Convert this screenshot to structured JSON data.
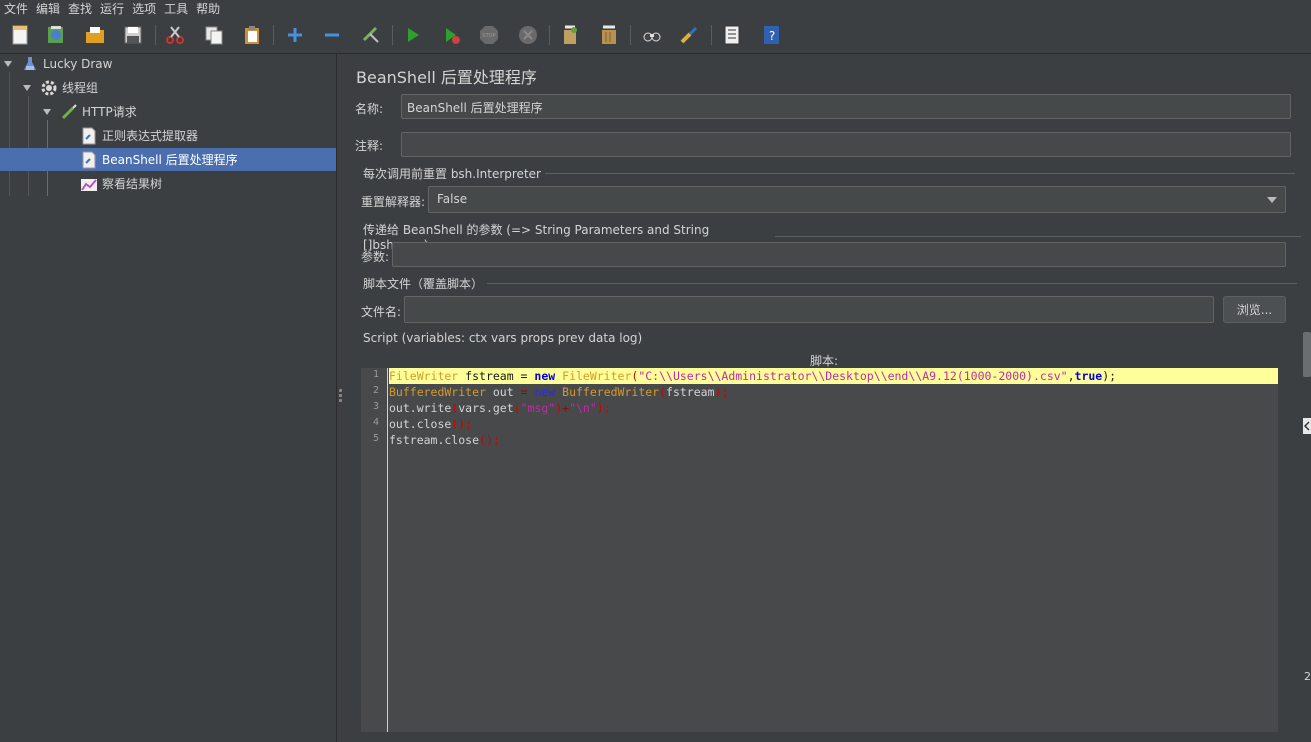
{
  "menu": [
    "文件",
    "编辑",
    "查找",
    "运行",
    "选项",
    "工具",
    "帮助"
  ],
  "toolbar": {
    "icons": [
      "new-icon",
      "templates-icon",
      "open-icon",
      "save-icon",
      "cut-icon",
      "copy-icon",
      "paste-icon",
      "expand-icon",
      "collapse-icon",
      "toggle-icon",
      "start-icon",
      "start-no-pause-icon",
      "stop-icon",
      "shutdown-icon",
      "clear-icon",
      "clear-all-icon",
      "search-icon",
      "reset-search-icon",
      "function-helper-icon",
      "help-icon"
    ]
  },
  "tree": {
    "root": "Lucky Draw",
    "thread_group": "线程组",
    "http_request": "HTTP请求",
    "regex_extractor": "正则表达式提取器",
    "beanshell": "BeanShell 后置处理程序",
    "result_tree": "察看结果树"
  },
  "panel": {
    "title": "BeanShell 后置处理程序",
    "name_label": "名称:",
    "name_value": "BeanShell 后置处理程序",
    "comment_label": "注释:",
    "comment_value": "",
    "reset_section": "每次调用前重置 bsh.Interpreter",
    "reset_label": "重置解释器:",
    "reset_value": "False",
    "params_section": "传递给 BeanShell 的参数 (=> String Parameters and String []bsh.args)",
    "params_label": "参数:",
    "params_value": "",
    "file_section": "脚本文件（覆盖脚本）",
    "file_label": "文件名:",
    "file_value": "",
    "browse_label": "浏览...",
    "script_section": "Script (variables: ctx vars props prev data log)",
    "script_caption": "脚本:"
  },
  "script": {
    "line_numbers": [
      "1",
      "2",
      "3",
      "4",
      "5"
    ],
    "line1": {
      "a": "FileWriter",
      "b": " fstream = ",
      "c": "new",
      "d": " ",
      "e": "FileWriter",
      "f": "(",
      "g": "\"C:\\\\Users\\\\Administrator\\\\Desktop\\\\end\\\\A9.12(1000-2000).csv\"",
      "h": ",",
      "i": "true",
      "j": ");"
    },
    "line2": {
      "a": "BufferedWriter",
      "b": " out ",
      "c": "=",
      "d": " ",
      "e": "new",
      "f": " ",
      "g": "BufferedWriter",
      "h": "(",
      "i": "fstream",
      "j": ");"
    },
    "line3": {
      "a": "out.write",
      "b": "(",
      "c": "vars.get",
      "d": "(",
      "e": "\"msg\"",
      "f": ")",
      "g": "+",
      "h": "\"\\n\"",
      "i": ");"
    },
    "line4": {
      "a": "out.close",
      "b": "();"
    },
    "line5": {
      "a": "fstream.close",
      "b": "();"
    }
  },
  "edge_number": "2"
}
